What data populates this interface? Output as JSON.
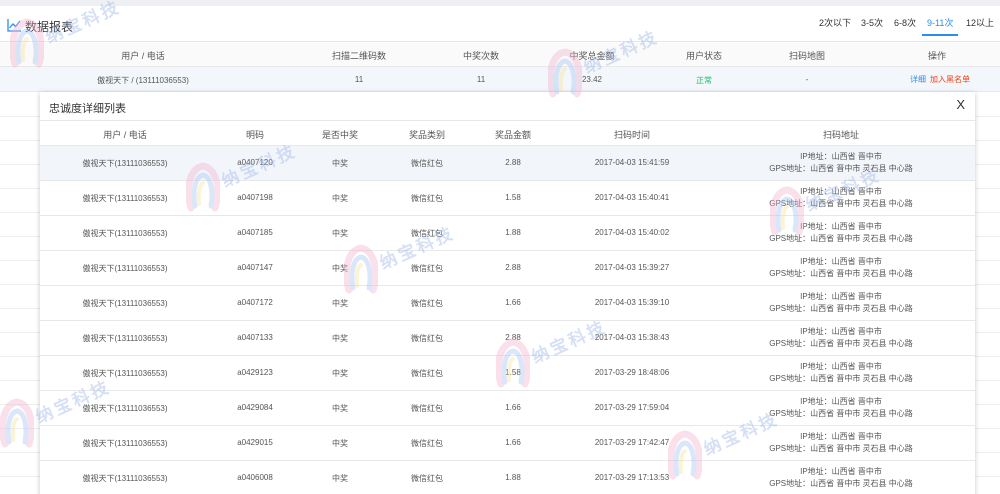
{
  "header": {
    "title": "数据报表",
    "range_tabs": [
      {
        "label": "2次以下"
      },
      {
        "label": "3-5次"
      },
      {
        "label": "6-8次"
      },
      {
        "label": "9-11次"
      },
      {
        "label": "12以上"
      }
    ],
    "active_tab": "9-11次",
    "accent_color": "#2d8cf0"
  },
  "main_table": {
    "columns": [
      "用户 / 电话",
      "扫描二维码数",
      "中奖次数",
      "中奖总金额",
      "用户状态",
      "扫码地图",
      "操作"
    ],
    "row": {
      "user": "傲视天下 / (13111036553)",
      "scans": "11",
      "wins": "11",
      "total_amount": "23.42",
      "status": "正常",
      "status_color": "#19be6b",
      "map": "-",
      "action_detail": "详细",
      "action_blacklist": "加入黑名单",
      "blacklist_color": "#ed3f14"
    }
  },
  "detail_modal": {
    "title": "忠诚度详细列表",
    "close_label": "X",
    "columns": [
      "用户 / 电话",
      "明码",
      "是否中奖",
      "奖品类别",
      "奖品金额",
      "扫码时间",
      "扫码地址"
    ],
    "rows": [
      {
        "user": "傲视天下(13111036553)",
        "code": "a0407120",
        "won": "中奖",
        "prize_type": "微信红包",
        "amount": "2.88",
        "time": "2017-04-03 15:41:59",
        "ip": "IP地址：山西省 晋中市",
        "gps": "GPS地址：山西省 晋中市 灵石县 中心路"
      },
      {
        "user": "傲视天下(13111036553)",
        "code": "a0407198",
        "won": "中奖",
        "prize_type": "微信红包",
        "amount": "1.58",
        "time": "2017-04-03 15:40:41",
        "ip": "IP地址：山西省 晋中市",
        "gps": "GPS地址：山西省 晋中市 灵石县 中心路"
      },
      {
        "user": "傲视天下(13111036553)",
        "code": "a0407185",
        "won": "中奖",
        "prize_type": "微信红包",
        "amount": "1.88",
        "time": "2017-04-03 15:40:02",
        "ip": "IP地址：山西省 晋中市",
        "gps": "GPS地址：山西省 晋中市 灵石县 中心路"
      },
      {
        "user": "傲视天下(13111036553)",
        "code": "a0407147",
        "won": "中奖",
        "prize_type": "微信红包",
        "amount": "2.88",
        "time": "2017-04-03 15:39:27",
        "ip": "IP地址：山西省 晋中市",
        "gps": "GPS地址：山西省 晋中市 灵石县 中心路"
      },
      {
        "user": "傲视天下(13111036553)",
        "code": "a0407172",
        "won": "中奖",
        "prize_type": "微信红包",
        "amount": "1.66",
        "time": "2017-04-03 15:39:10",
        "ip": "IP地址：山西省 晋中市",
        "gps": "GPS地址：山西省 晋中市 灵石县 中心路"
      },
      {
        "user": "傲视天下(13111036553)",
        "code": "a0407133",
        "won": "中奖",
        "prize_type": "微信红包",
        "amount": "2.88",
        "time": "2017-04-03 15:38:43",
        "ip": "IP地址：山西省 晋中市",
        "gps": "GPS地址：山西省 晋中市 灵石县 中心路"
      },
      {
        "user": "傲视天下(13111036553)",
        "code": "a0429123",
        "won": "中奖",
        "prize_type": "微信红包",
        "amount": "1.58",
        "time": "2017-03-29 18:48:06",
        "ip": "IP地址：山西省 晋中市",
        "gps": "GPS地址：山西省 晋中市 灵石县 中心路"
      },
      {
        "user": "傲视天下(13111036553)",
        "code": "a0429084",
        "won": "中奖",
        "prize_type": "微信红包",
        "amount": "1.66",
        "time": "2017-03-29 17:59:04",
        "ip": "IP地址：山西省 晋中市",
        "gps": "GPS地址：山西省 晋中市 灵石县 中心路"
      },
      {
        "user": "傲视天下(13111036553)",
        "code": "a0429015",
        "won": "中奖",
        "prize_type": "微信红包",
        "amount": "1.66",
        "time": "2017-03-29 17:42:47",
        "ip": "IP地址：山西省 晋中市",
        "gps": "GPS地址：山西省 晋中市 灵石县 中心路"
      },
      {
        "user": "傲视天下(13111036553)",
        "code": "a0406008",
        "won": "中奖",
        "prize_type": "微信红包",
        "amount": "1.88",
        "time": "2017-03-29 17:13:53",
        "ip": "IP地址：山西省 晋中市",
        "gps": "GPS地址：山西省 晋中市 灵石县 中心路"
      }
    ]
  },
  "watermark": {
    "text": "纳宝科技"
  }
}
